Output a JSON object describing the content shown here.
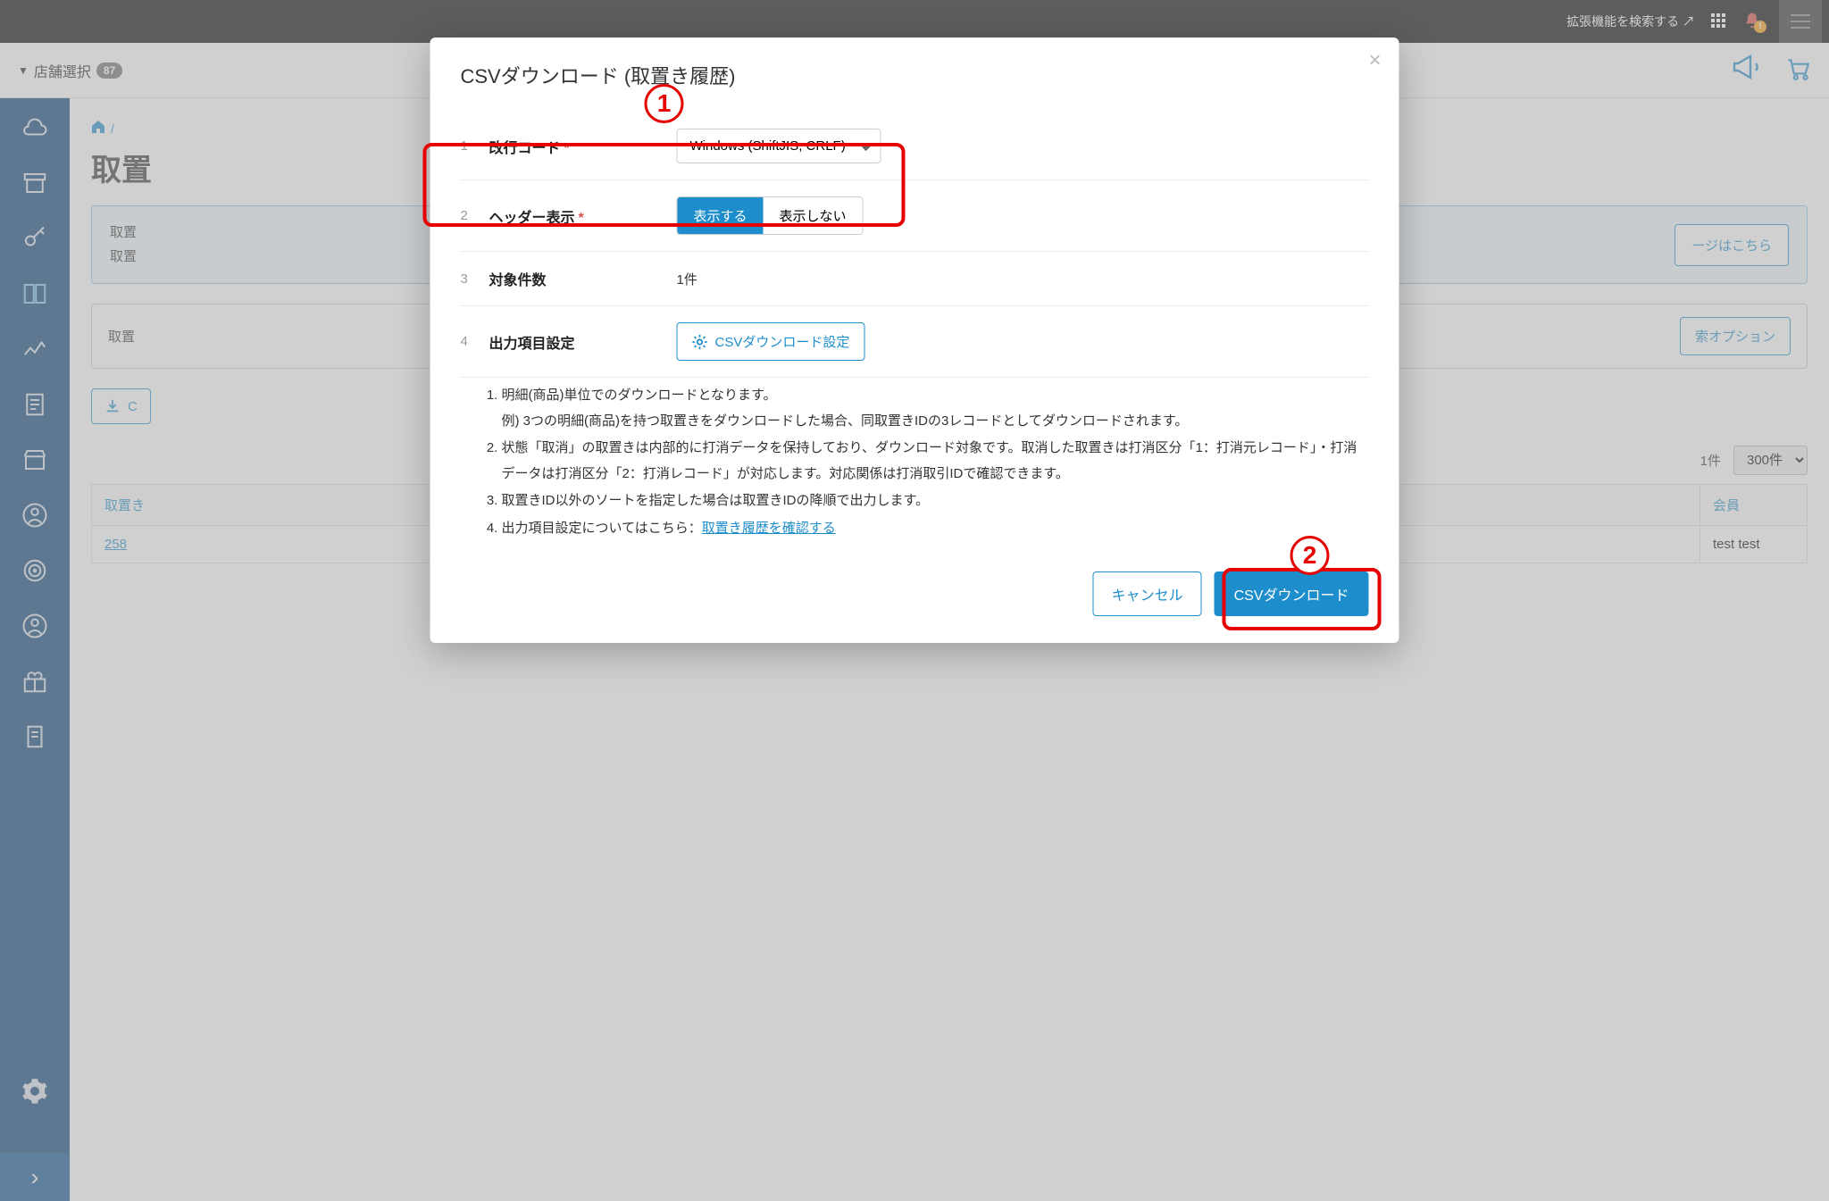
{
  "annotations": {
    "marker1": "1",
    "marker2": "2"
  },
  "topbar": {
    "ext_search": "拡張機能を検索する",
    "bell_warn": "!"
  },
  "header": {
    "store_select_label": "店舗選択",
    "store_badge": "87"
  },
  "breadcrumb": {
    "sep": "/"
  },
  "page": {
    "title": "取置",
    "info_line1": "取置",
    "info_line2": "取置",
    "info_link_btn": "ージはこちら",
    "search_label": "取置",
    "search_opt_btn": "索オプション",
    "csv_bg_btn": "C",
    "result_count": "1件",
    "page_size": "300件",
    "th_id": "取置き",
    "th_member": "会員",
    "td_id": "258",
    "td_member": "test test"
  },
  "modal": {
    "title": "CSVダウンロード (取置き履歴)",
    "row1": {
      "num": "1",
      "label": "改行コード",
      "select": "Windows (ShiftJIS, CRLF)"
    },
    "row2": {
      "num": "2",
      "label": "ヘッダー表示",
      "opt_show": "表示する",
      "opt_hide": "表示しない"
    },
    "row3": {
      "num": "3",
      "label": "対象件数",
      "value": "1件"
    },
    "row4": {
      "num": "4",
      "label": "出力項目設定",
      "btn": "CSVダウンロード設定"
    },
    "notes": {
      "n1": "明細(商品)単位でのダウンロードとなります。",
      "n1sub": "例) 3つの明細(商品)を持つ取置きをダウンロードした場合、同取置きIDの3レコードとしてダウンロードされます。",
      "n2": "状態「取消」の取置きは内部的に打消データを保持しており、ダウンロード対象です。取消した取置きは打消区分「1：打消元レコード」・打消データは打消区分「2：打消レコード」が対応します。対応関係は打消取引IDで確認できます。",
      "n3": "取置きID以外のソートを指定した場合は取置きIDの降順で出力します。",
      "n4_pre": "出力項目設定についてはこちら：",
      "n4_link": "取置き履歴を確認する"
    },
    "cancel": "キャンセル",
    "download": "CSVダウンロード"
  }
}
